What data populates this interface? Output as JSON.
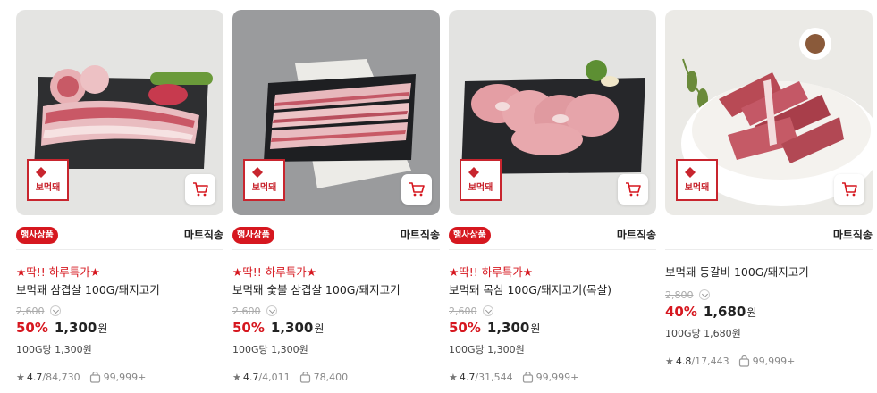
{
  "products": [
    {
      "logo_text": "보먹돼",
      "badge": "행사상품",
      "shipping": "마트직송",
      "promo": "★딱!! 하루특가★",
      "title": "보먹돼 삼겹살 100G/돼지고기",
      "original_price": "2,600",
      "discount": "50%",
      "price": "1,300",
      "won": "원",
      "unit_price": "100G당 1,300원",
      "rating": "4.7",
      "reviews": "/84,730",
      "sold": "99,999+"
    },
    {
      "logo_text": "보먹돼",
      "badge": "행사상품",
      "shipping": "마트직송",
      "promo": "★딱!! 하루특가★",
      "title": "보먹돼 숯불 삼겹살 100G/돼지고기",
      "original_price": "2,600",
      "discount": "50%",
      "price": "1,300",
      "won": "원",
      "unit_price": "100G당 1,300원",
      "rating": "4.7",
      "reviews": "/4,011",
      "sold": "78,400"
    },
    {
      "logo_text": "보먹돼",
      "badge": "행사상품",
      "shipping": "마트직송",
      "promo": "★딱!! 하루특가★",
      "title": "보먹돼 목심 100G/돼지고기(목살)",
      "original_price": "2,600",
      "discount": "50%",
      "price": "1,300",
      "won": "원",
      "unit_price": "100G당 1,300원",
      "rating": "4.7",
      "reviews": "/31,544",
      "sold": "99,999+"
    },
    {
      "logo_text": "보먹돼",
      "badge": "",
      "shipping": "마트직송",
      "promo": "",
      "title": "보먹돼 등갈비 100G/돼지고기",
      "original_price": "2,800",
      "discount": "40%",
      "price": "1,680",
      "won": "원",
      "unit_price": "100G당 1,680원",
      "rating": "4.8",
      "reviews": "/17,443",
      "sold": "99,999+"
    }
  ],
  "colors": {
    "accent": "#d6171f",
    "text": "#222222",
    "muted": "#888888"
  },
  "icons": {
    "cart": "cart-icon",
    "star": "star-icon",
    "bag": "shopping-bag-icon",
    "chevron": "chevron-down-icon"
  }
}
